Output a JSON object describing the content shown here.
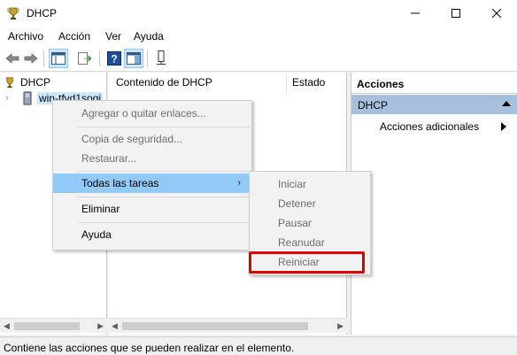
{
  "window": {
    "title": "DHCP",
    "controls": {
      "minimize": "minimize",
      "maximize": "maximize",
      "close": "close"
    }
  },
  "menubar": {
    "items": [
      "Archivo",
      "Acción",
      "Ver",
      "Ayuda"
    ]
  },
  "toolbar": {
    "buttons": [
      "back-arrow-icon",
      "forward-arrow-icon",
      "console-tree-icon",
      "export-list-icon",
      "help-icon",
      "show-hide-action-pane-icon",
      "server-icon"
    ]
  },
  "tree": {
    "root": "DHCP",
    "server": "win-tfvd1sogi"
  },
  "list": {
    "columns": [
      "Contenido de DHCP",
      "Estado"
    ]
  },
  "actions": {
    "header": "Acciones",
    "group": "DHCP",
    "item": "Acciones adicionales"
  },
  "context_menu": {
    "items": [
      {
        "label": "Agregar o quitar enlaces...",
        "disabled": true
      },
      {
        "label": "Copia de seguridad...",
        "disabled": true
      },
      {
        "label": "Restaurar...",
        "disabled": true
      },
      {
        "label": "Todas las tareas",
        "disabled": false,
        "submenu": true
      },
      {
        "label": "Eliminar",
        "disabled": false
      },
      {
        "label": "Ayuda",
        "disabled": false
      }
    ]
  },
  "submenu": {
    "items": [
      {
        "label": "Iniciar",
        "disabled": true
      },
      {
        "label": "Detener",
        "disabled": true
      },
      {
        "label": "Pausar",
        "disabled": true
      },
      {
        "label": "Reanudar",
        "disabled": true
      },
      {
        "label": "Reiniciar",
        "disabled": true,
        "highlighted": true
      }
    ]
  },
  "statusbar": {
    "text": "Contiene las acciones que se pueden realizar en el elemento."
  },
  "colors": {
    "hover": "#91c9f7",
    "action_group": "#a7c1dd",
    "highlight": "#e00000",
    "selection": "#cce8ff"
  }
}
